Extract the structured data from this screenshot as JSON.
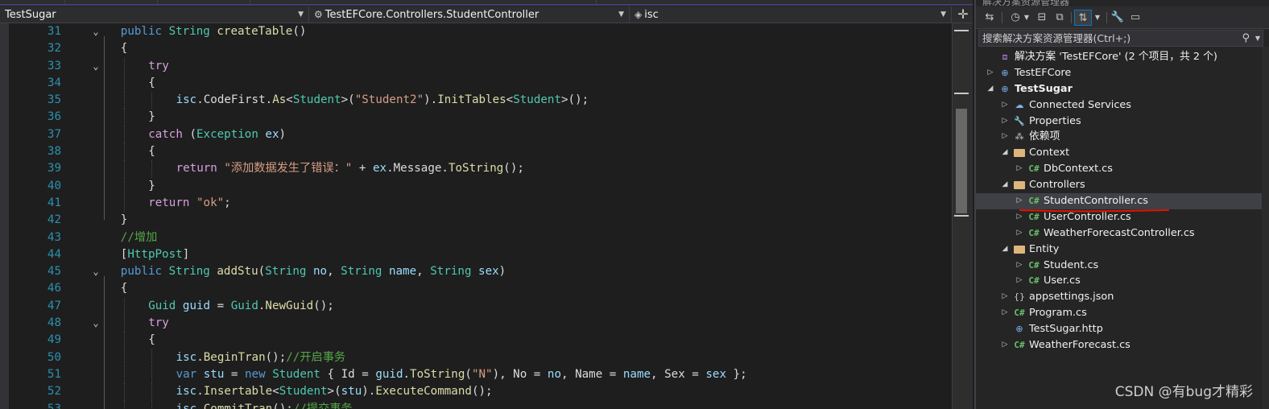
{
  "nav": {
    "project": "TestSugar",
    "class_path": "TestEFCore.Controllers.StudentController",
    "member": "isc"
  },
  "editor": {
    "lines": [
      {
        "n": "31",
        "fold": "v",
        "indent": 2,
        "html": "<span class='kw'>public</span> <span class='ty'>String</span> <span class='fn'>createTable</span>()"
      },
      {
        "n": "32",
        "fold": "",
        "indent": 2,
        "html": "{"
      },
      {
        "n": "33",
        "fold": "v",
        "indent": 3,
        "html": "<span class='kw2'>try</span>"
      },
      {
        "n": "34",
        "fold": "",
        "indent": 3,
        "html": "{"
      },
      {
        "n": "35",
        "fold": "",
        "indent": 4,
        "html": "<span class='var'>isc</span>.CodeFirst.<span class='fn'>As</span>&lt;<span class='ty'>Student</span>&gt;(<span class='str'>\"Student2\"</span>).<span class='fn'>InitTables</span>&lt;<span class='ty'>Student</span>&gt;();"
      },
      {
        "n": "36",
        "fold": "",
        "indent": 3,
        "html": "}"
      },
      {
        "n": "37",
        "fold": "",
        "indent": 3,
        "html": "<span class='kw2'>catch</span> (<span class='ty'>Exception</span> <span class='var'>ex</span>)"
      },
      {
        "n": "38",
        "fold": "",
        "indent": 3,
        "html": "{"
      },
      {
        "n": "39",
        "fold": "",
        "indent": 4,
        "html": "<span class='kw2'>return</span> <span class='str'>\"添加数据发生了错误：\"</span> + <span class='var'>ex</span>.Message.<span class='fn'>ToString</span>();"
      },
      {
        "n": "40",
        "fold": "",
        "indent": 3,
        "html": "}"
      },
      {
        "n": "41",
        "fold": "",
        "indent": 3,
        "html": "<span class='kw2'>return</span> <span class='str'>\"ok\"</span>;"
      },
      {
        "n": "42",
        "fold": "",
        "indent": 2,
        "html": "}"
      },
      {
        "n": "43",
        "fold": "",
        "indent": 2,
        "html": "<span class='cm'>//增加</span>"
      },
      {
        "n": "44",
        "fold": "",
        "indent": 2,
        "html": "[<span class='attr'>HttpPost</span>]"
      },
      {
        "n": "45",
        "fold": "v",
        "indent": 2,
        "html": "<span class='kw'>public</span> <span class='ty'>String</span> <span class='fn'>addStu</span>(<span class='ty'>String</span> <span class='var'>no</span>, <span class='ty'>String</span> <span class='var'>name</span>, <span class='ty'>String</span> <span class='var'>sex</span>)"
      },
      {
        "n": "46",
        "fold": "",
        "indent": 2,
        "html": "{"
      },
      {
        "n": "47",
        "fold": "",
        "indent": 3,
        "html": "<span class='ty'>Guid</span> <span class='var'>guid</span> = <span class='ty'>Guid</span>.<span class='fn'>NewGuid</span>();"
      },
      {
        "n": "48",
        "fold": "v",
        "indent": 3,
        "html": "<span class='kw2'>try</span>"
      },
      {
        "n": "49",
        "fold": "",
        "indent": 3,
        "html": "{"
      },
      {
        "n": "50",
        "fold": "",
        "indent": 4,
        "html": "<span class='var'>isc</span>.<span class='fn'>BeginTran</span>();<span class='cm'>//开启事务</span>"
      },
      {
        "n": "51",
        "fold": "",
        "indent": 4,
        "html": "<span class='kw'>var</span> <span class='var'>stu</span> = <span class='kw'>new</span> <span class='ty'>Student</span> { Id = <span class='var'>guid</span>.<span class='fn'>ToString</span>(<span class='str'>\"N\"</span>), No = <span class='var'>no</span>, Name = <span class='var'>name</span>, Sex = <span class='var'>sex</span> };"
      },
      {
        "n": "52",
        "fold": "",
        "indent": 4,
        "html": "<span class='var'>isc</span>.<span class='fn'>Insertable</span>&lt;<span class='ty'>Student</span>&gt;(<span class='var'>stu</span>).<span class='fn'>ExecuteCommand</span>();"
      },
      {
        "n": "53",
        "fold": "",
        "indent": 4,
        "html": "<span class='var'>isc</span>.<span class='fn'>CommitTran</span>();<span class='cm'>//提交事务</span>"
      }
    ]
  },
  "solution_explorer": {
    "title": "解决方案资源管理器",
    "search_placeholder": "搜索解决方案资源管理器(Ctrl+;)",
    "tree": [
      {
        "level": 0,
        "exp": "",
        "icon": "solution",
        "label": "解决方案 'TestEFCore' (2 个项目，共 2 个)"
      },
      {
        "level": 0,
        "exp": "▷",
        "icon": "project",
        "label": "TestEFCore"
      },
      {
        "level": 0,
        "exp": "◢",
        "icon": "project",
        "label": "TestSugar",
        "bold": true
      },
      {
        "level": 1,
        "exp": "▷",
        "icon": "services",
        "label": "Connected Services"
      },
      {
        "level": 1,
        "exp": "▷",
        "icon": "properties",
        "label": "Properties"
      },
      {
        "level": 1,
        "exp": "▷",
        "icon": "deps",
        "label": "依赖项"
      },
      {
        "level": 1,
        "exp": "◢",
        "icon": "folder",
        "label": "Context"
      },
      {
        "level": 2,
        "exp": "▷",
        "icon": "cs",
        "label": "DbContext.cs"
      },
      {
        "level": 1,
        "exp": "◢",
        "icon": "folder",
        "label": "Controllers"
      },
      {
        "level": 2,
        "exp": "▷",
        "icon": "cs",
        "label": "StudentController.cs",
        "selected": true
      },
      {
        "level": 2,
        "exp": "▷",
        "icon": "cs",
        "label": "UserController.cs"
      },
      {
        "level": 2,
        "exp": "▷",
        "icon": "cs",
        "label": "WeatherForecastController.cs"
      },
      {
        "level": 1,
        "exp": "◢",
        "icon": "folder",
        "label": "Entity"
      },
      {
        "level": 2,
        "exp": "▷",
        "icon": "cs",
        "label": "Student.cs"
      },
      {
        "level": 2,
        "exp": "▷",
        "icon": "cs",
        "label": "User.cs"
      },
      {
        "level": 1,
        "exp": "▷",
        "icon": "json",
        "label": "appsettings.json"
      },
      {
        "level": 1,
        "exp": "▷",
        "icon": "cs",
        "label": "Program.cs"
      },
      {
        "level": 1,
        "exp": "",
        "icon": "web",
        "label": "TestSugar.http"
      },
      {
        "level": 1,
        "exp": "▷",
        "icon": "cs",
        "label": "WeatherForecast.cs"
      }
    ]
  },
  "watermark": "CSDN @有bug才精彩",
  "colors": {
    "background": "#1e1e1e",
    "panel": "#252526",
    "accent": "#007acc",
    "annotation": "#e51400"
  }
}
